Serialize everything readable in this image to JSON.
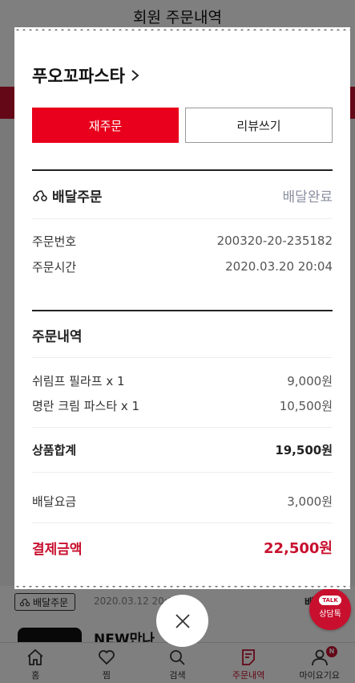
{
  "page_title": "회원 주문내역",
  "background_order": {
    "type_label": "배달주문",
    "date": "2020.03.12 20:0",
    "status": "배",
    "name": "NEW만나"
  },
  "talk_button": {
    "badge": "TALK",
    "label": "상담톡"
  },
  "modal": {
    "store_name": "푸오꼬파스타",
    "reorder_label": "재주문",
    "review_label": "리뷰쓰기",
    "delivery_type": "배달주문",
    "delivery_status": "배달완료",
    "order_number_label": "주문번호",
    "order_number": "200320-20-235182",
    "order_time_label": "주문시간",
    "order_time": "2020.03.20 20:04",
    "order_details_title": "주문내역",
    "items": [
      {
        "name": "쉬림프 필라프 x 1",
        "price": "9,000원"
      },
      {
        "name": "명란 크림 파스타 x 1",
        "price": "10,500원"
      }
    ],
    "subtotal_label": "상품합계",
    "subtotal": "19,500원",
    "delivery_fee_label": "배달요금",
    "delivery_fee": "3,000원",
    "total_label": "결제금액",
    "total": "22,500원"
  },
  "bottom_nav": [
    {
      "label": "홈",
      "icon": "home-icon"
    },
    {
      "label": "찜",
      "icon": "heart-icon"
    },
    {
      "label": "검색",
      "icon": "search-icon"
    },
    {
      "label": "주문내역",
      "icon": "order-list-icon"
    },
    {
      "label": "마이요기요",
      "icon": "user-icon",
      "badge": "N"
    }
  ],
  "colors": {
    "accent": "#e8001c",
    "brand": "#c8102e",
    "status_gray": "#8b90a0"
  }
}
